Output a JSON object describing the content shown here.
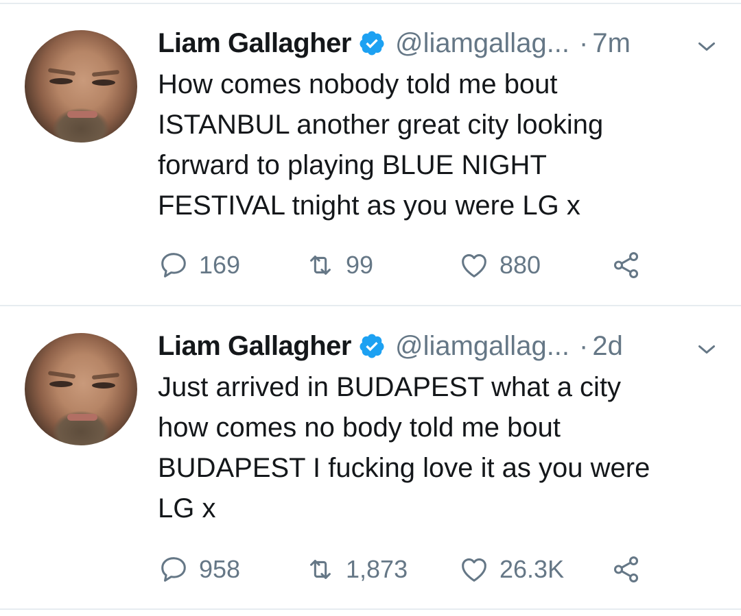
{
  "tweets": [
    {
      "author": "Liam Gallagher",
      "handle": "@liamgallag...",
      "separator": "·",
      "time": "7m",
      "text_lines": [
        "How comes nobody told me bout",
        "ISTANBUL another great city looking",
        "forward to playing BLUE NIGHT",
        "FESTIVAL tnight as you were LG x"
      ],
      "replies": "169",
      "retweets": "99",
      "likes": "880"
    },
    {
      "author": "Liam Gallagher",
      "handle": "@liamgallag...",
      "separator": "·",
      "time": "2d",
      "text_lines": [
        "Just arrived in BUDAPEST what a city",
        "how comes no body told me bout",
        "BUDAPEST I fucking love it as you were",
        "LG x"
      ],
      "replies": "958",
      "retweets": "1,873",
      "likes": "26.3K"
    }
  ],
  "colors": {
    "verified": "#1da1f2",
    "secondary_text": "#657786",
    "divider": "#e6ecf0"
  },
  "icons": [
    "verified-badge-icon",
    "caret-down-icon",
    "reply-icon",
    "retweet-icon",
    "like-icon",
    "share-icon"
  ]
}
